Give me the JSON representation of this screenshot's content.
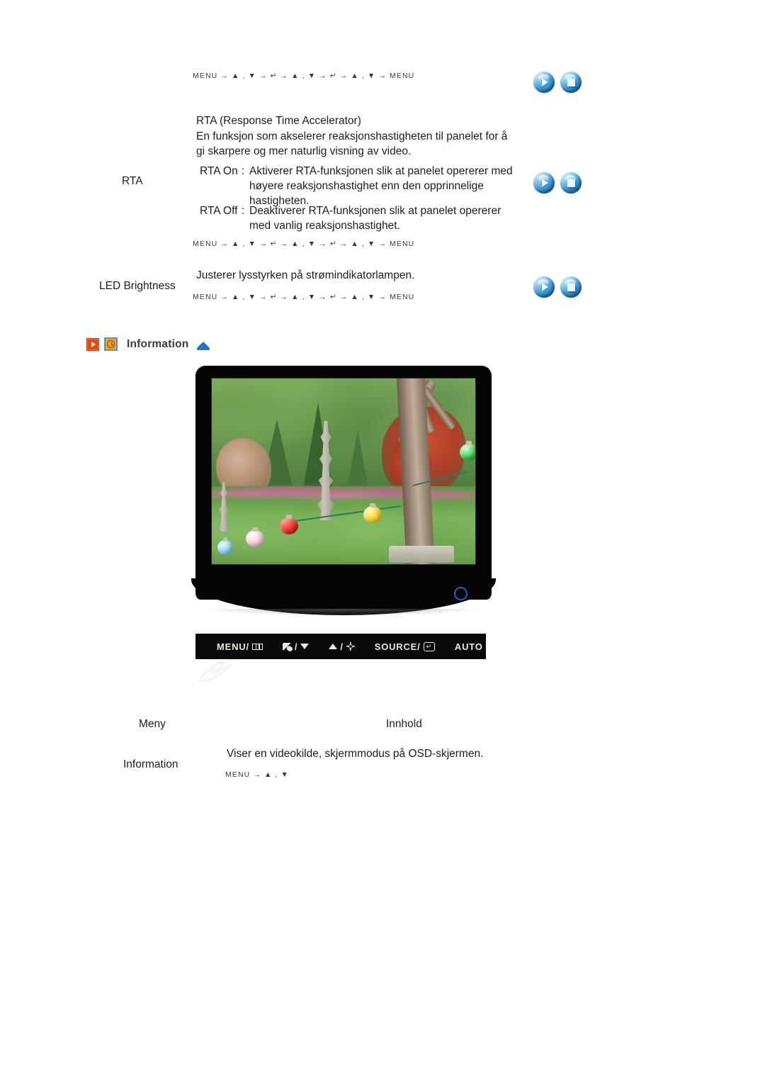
{
  "meta": {
    "accent_orange": "#e8450f",
    "accent_blue": "#1f74c8",
    "orb_blue": "#3f9ddb"
  },
  "top_menu_path": {
    "parts": [
      "MENU",
      "→",
      "▲ , ▼",
      "→",
      "↵",
      "→",
      "▲ , ▼",
      "→",
      "↵",
      "→",
      "▲ , ▼",
      "→",
      "MENU"
    ],
    "text": "MENU → ▲ , ▼ → ↵ → ▲ , ▼ → ↵ → ▲ , ▼ → MENU"
  },
  "rta_section": {
    "label": "RTA",
    "title": "RTA (Response Time Accelerator)",
    "description_line1": "En funksjon som akselerer reaksjonshastigheten til panelet for å",
    "description_line2": "gi skarpere og mer naturlig visning av video.",
    "options": [
      {
        "name": "RTA On",
        "colon": ":",
        "lines": [
          "Aktiverer RTA-funksjonen slik at panelet opererer med",
          "høyere reaksjonshastighet enn den opprinnelige",
          "hastigheten."
        ]
      },
      {
        "name": "RTA Off",
        "colon": ":",
        "lines": [
          "Deaktiverer RTA-funksjonen slik at panelet opererer",
          "med vanlig reaksjonshastighet."
        ]
      }
    ],
    "menu_path": "MENU → ▲ , ▼ → ↵ → ▲ , ▼ → ↵ → ▲ , ▼ → MENU"
  },
  "led_section": {
    "label": "LED Brightness",
    "description": "Justerer lysstyrken på strømindikatorlampen.",
    "menu_path": "MENU → ▲ , ▼ → ↵ → ▲ , ▼ → ↵ → ▲ , ▼ → MENU"
  },
  "information_header": {
    "title": "Information",
    "play_icon": "play-square-icon",
    "clock_icon": "clock-icon",
    "top_icon": "scroll-to-top-icon"
  },
  "monitor": {
    "screen_image_alt": "Garden with stone pagoda, trees and colored paper lanterns",
    "power_led": "power-led-indicator",
    "controls": [
      {
        "label": "MENU/",
        "icon": "menu-bars-icon"
      },
      {
        "label": "/",
        "icon_left": "contrast-icon",
        "icon_right": "down-arrow-icon"
      },
      {
        "label": "/",
        "icon_left": "up-arrow-icon",
        "icon_right": "brightness-sun-icon"
      },
      {
        "label": "SOURCE/",
        "icon": "enter-key-icon"
      },
      {
        "label": "AUTO",
        "icon": ""
      }
    ],
    "control_labels": {
      "menu": "MENU/",
      "source": "SOURCE/",
      "auto": "AUTO",
      "slash": "/",
      "enter_key": "↵"
    }
  },
  "table": {
    "headers": {
      "menu": "Meny",
      "content": "Innhold"
    },
    "rows": [
      {
        "menu": "Information",
        "content": "Viser en videokilde, skjermmodus på OSD-skjermen.",
        "menu_path": "MENU → ▲ , ▼"
      }
    ]
  },
  "nav_orbs": {
    "prev_label": "previous-page",
    "next_label": "next-page"
  }
}
